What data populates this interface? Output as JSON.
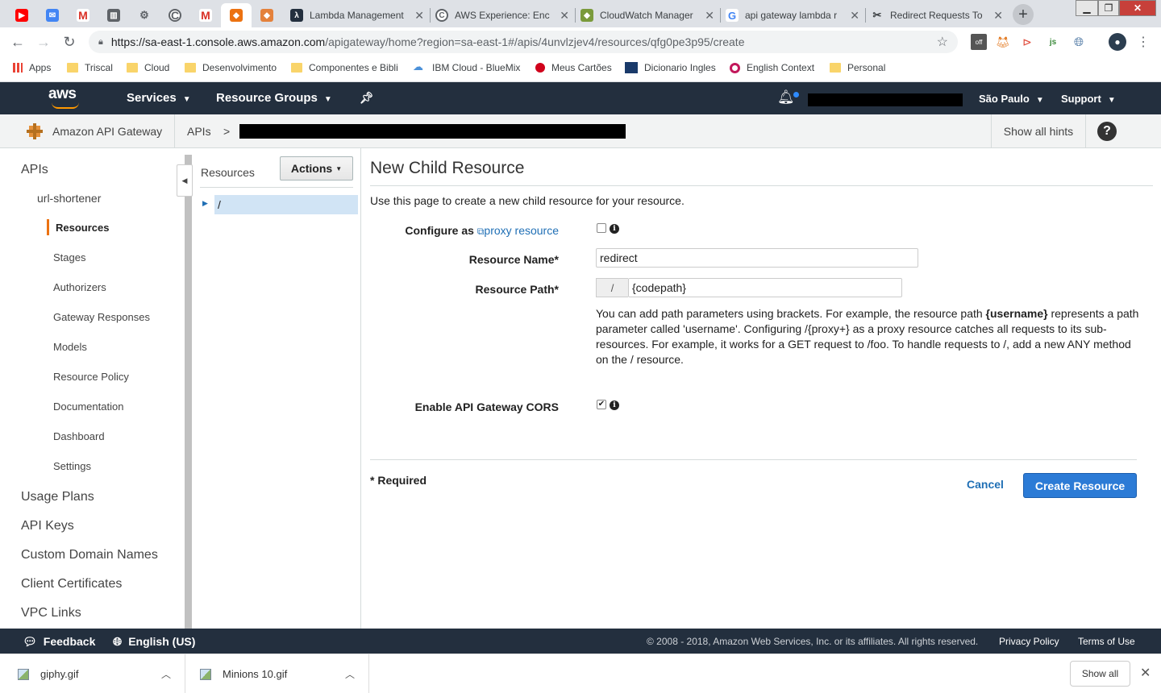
{
  "browser": {
    "pinned_tabs": [
      {
        "icon": "youtube-icon",
        "color": "#ff0000",
        "glyph": "▶"
      },
      {
        "icon": "inbox-icon",
        "color": "#4285f4",
        "glyph": "✉"
      },
      {
        "icon": "gmail-icon",
        "color": "#d93025",
        "glyph": "M"
      },
      {
        "icon": "trello-icon",
        "color": "#5f6368",
        "glyph": "▥"
      },
      {
        "icon": "network-icon",
        "color": "#5f6368",
        "glyph": "⚙"
      },
      {
        "icon": "codepath-icon",
        "color": "#5f6368",
        "glyph": "C"
      },
      {
        "icon": "gmail-icon",
        "color": "#d93025",
        "glyph": "M"
      },
      {
        "icon": "aws-cube-icon",
        "color": "#ec7211",
        "glyph": "◆"
      },
      {
        "icon": "aws-cube-icon",
        "color": "#e4813b",
        "glyph": "◆"
      }
    ],
    "tabs": [
      {
        "title": "Lambda Management",
        "icon": "lambda-icon"
      },
      {
        "title": "AWS Experience: Enc",
        "icon": "codepath-icon"
      },
      {
        "title": "CloudWatch Manager",
        "icon": "cloudwatch-icon"
      },
      {
        "title": "api gateway lambda r",
        "icon": "google-icon"
      },
      {
        "title": "Redirect Requests To",
        "icon": "tools-icon"
      }
    ],
    "url_host": "https://sa-east-1.console.aws.amazon.com",
    "url_path": "/apigateway/home?region=sa-east-1#/apis/4unvlzjev4/resources/qfg0pe3p95/create",
    "bookmarks": [
      {
        "label": "Apps",
        "type": "apps"
      },
      {
        "label": "Triscal",
        "type": "folder"
      },
      {
        "label": "Cloud",
        "type": "folder"
      },
      {
        "label": "Desenvolvimento",
        "type": "folder"
      },
      {
        "label": "Componentes e Bibli",
        "type": "folder"
      },
      {
        "label": "IBM Cloud - BlueMix",
        "type": "cloud"
      },
      {
        "label": "Meus Cartões",
        "type": "dot"
      },
      {
        "label": "Dicionario Ingles",
        "type": "dict"
      },
      {
        "label": "English Context",
        "type": "ctx"
      },
      {
        "label": "Personal",
        "type": "folder"
      }
    ]
  },
  "aws_nav": {
    "logo": "aws",
    "services": "Services",
    "resource_groups": "Resource Groups",
    "region": "São Paulo",
    "support": "Support"
  },
  "service_bar": {
    "service_name": "Amazon API Gateway",
    "breadcrumb_root": "APIs",
    "breadcrumb_sep": ">",
    "show_hints": "Show all hints",
    "help": "?"
  },
  "sidebar": {
    "apis": "APIs",
    "api_name": "url-shortener",
    "items": [
      "Resources",
      "Stages",
      "Authorizers",
      "Gateway Responses",
      "Models",
      "Resource Policy",
      "Documentation",
      "Dashboard",
      "Settings"
    ],
    "sections": [
      "Usage Plans",
      "API Keys",
      "Custom Domain Names",
      "Client Certificates",
      "VPC Links"
    ]
  },
  "tree": {
    "title": "Resources",
    "actions": "Actions",
    "root": "/"
  },
  "form": {
    "heading": "New Child Resource",
    "description": "Use this page to create a new child resource for your resource.",
    "configure_as": "Configure as",
    "proxy_link": "proxy resource",
    "resource_name_label": "Resource Name*",
    "resource_name_value": "redirect",
    "resource_path_label": "Resource Path*",
    "resource_path_prefix": "/",
    "resource_path_value": "{codepath}",
    "help_1": "You can add path parameters using brackets. For example, the resource path ",
    "help_bold": "{username}",
    "help_2": " represents a path parameter called 'username'. Configuring /{proxy+} as a proxy resource catches all requests to its sub-resources. For example, it works for a GET request to /foo. To handle requests to /, add a new ANY method on the / resource.",
    "cors_label": "Enable API Gateway CORS",
    "proxy_checked": false,
    "cors_checked": true,
    "required_note": "* Required",
    "cancel": "Cancel",
    "create": "Create Resource"
  },
  "footer": {
    "feedback": "Feedback",
    "language": "English (US)",
    "copyright": "© 2008 - 2018, Amazon Web Services, Inc. or its affiliates. All rights reserved.",
    "privacy": "Privacy Policy",
    "terms": "Terms of Use"
  },
  "downloads": {
    "items": [
      "giphy.gif",
      "Minions 10.gif"
    ],
    "show_all": "Show all"
  }
}
